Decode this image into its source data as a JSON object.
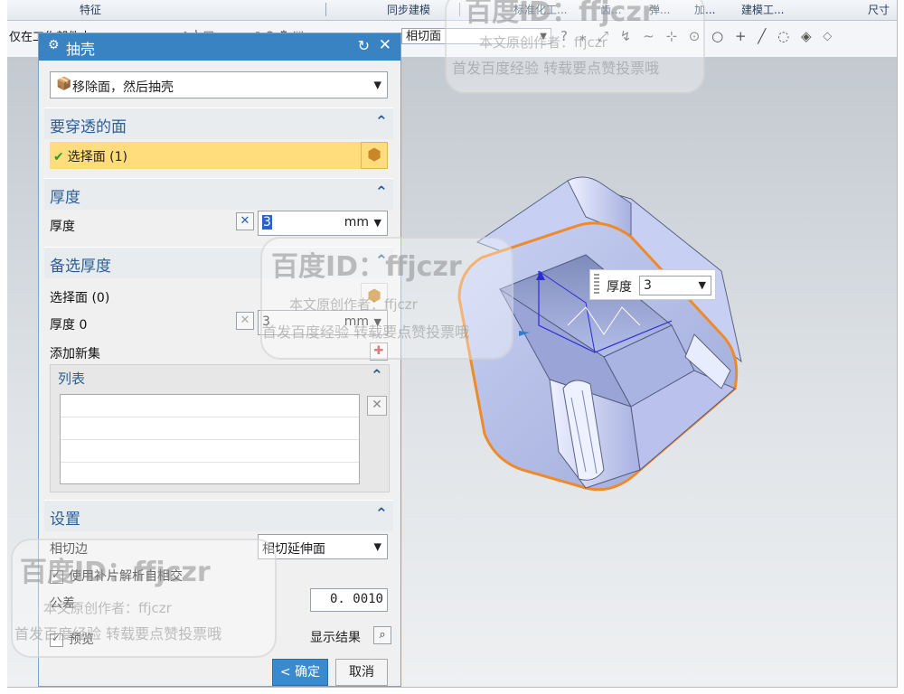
{
  "ribbon": {
    "groups": [
      "特征",
      "同步建模",
      "标准化工...",
      "齿...",
      "弹...",
      "加...",
      "建模工...",
      "尺寸"
    ]
  },
  "toolbar": {
    "filter_label": "仅在工作部件内",
    "tangent_combo": "相切面"
  },
  "dialog": {
    "title": "抽壳",
    "type_value": "移除面，然后抽壳",
    "sections": {
      "faces": {
        "header": "要穿透的面",
        "select_label": "选择面 (1)"
      },
      "thickness": {
        "header": "厚度",
        "label": "厚度",
        "value": "3",
        "unit": "mm"
      },
      "alt_thickness": {
        "header": "备选厚度",
        "select_label": "选择面 (0)",
        "thickness_label": "厚度 0",
        "value": "3",
        "unit": "mm",
        "add_set_label": "添加新集",
        "list_header": "列表"
      },
      "settings": {
        "header": "设置",
        "tangent_label": "相切边",
        "tangent_value": "相切延伸面",
        "use_patch_label": "使用补片解析自相交",
        "tolerance_label": "公差",
        "tolerance_value": "0. 0010"
      }
    },
    "preview_label": "预览",
    "show_result_label": "显示结果",
    "ok_label": "< 确定 >",
    "cancel_label": "取消"
  },
  "popup": {
    "label": "厚度",
    "value": "3"
  },
  "watermarks": {
    "id_text": "百度ID：ffjczr",
    "author_text": "本文原创作者：ffjczr",
    "promo_text": "首发百度经验 转载要点赞投票哦"
  }
}
